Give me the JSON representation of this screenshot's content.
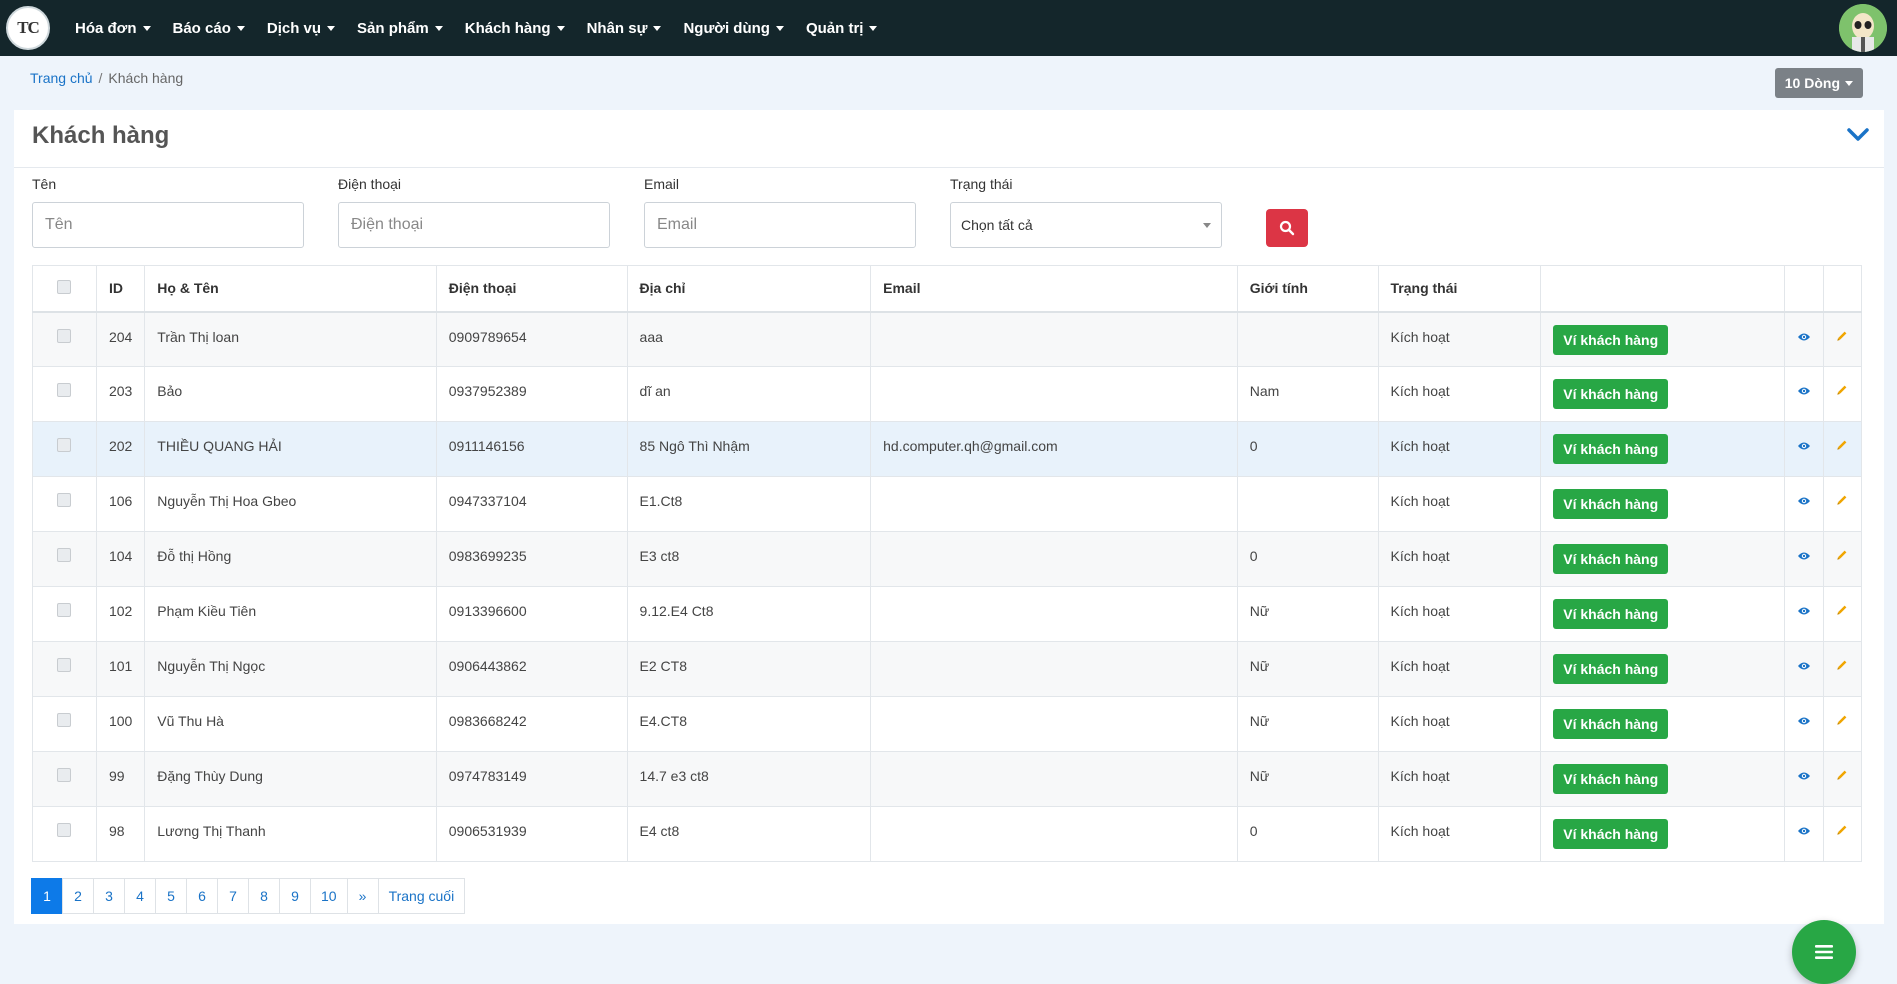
{
  "logo_text": "TC",
  "nav": {
    "items": [
      {
        "label": "Hóa đơn"
      },
      {
        "label": "Báo cáo"
      },
      {
        "label": "Dịch vụ"
      },
      {
        "label": "Sản phẩm"
      },
      {
        "label": "Khách hàng"
      },
      {
        "label": "Nhân sự"
      },
      {
        "label": "Người dùng"
      },
      {
        "label": "Quản trị"
      }
    ]
  },
  "breadcrumb": {
    "home": "Trang chủ",
    "sep": "/",
    "current": "Khách hàng"
  },
  "rows_per_page": "10 Dòng",
  "page_title": "Khách hàng",
  "filters": {
    "name": {
      "label": "Tên",
      "placeholder": "Tên"
    },
    "phone": {
      "label": "Điện thoại",
      "placeholder": "Điện thoại"
    },
    "email": {
      "label": "Email",
      "placeholder": "Email"
    },
    "status": {
      "label": "Trạng thái",
      "value": "Chọn tất cả"
    }
  },
  "table": {
    "headers": {
      "id": "ID",
      "name": "Họ & Tên",
      "phone": "Điện thoại",
      "address": "Địa chỉ",
      "email": "Email",
      "gender": "Giới tính",
      "status": "Trạng thái"
    },
    "wallet_label": "Ví khách hàng",
    "rows": [
      {
        "id": "204",
        "name": "Trần Thị loan",
        "phone": "0909789654",
        "address": "aaa",
        "email": "",
        "gender": "",
        "status": "Kích hoạt"
      },
      {
        "id": "203",
        "name": "Bảo",
        "phone": "0937952389",
        "address": "dĩ an",
        "email": "",
        "gender": "Nam",
        "status": "Kích hoạt"
      },
      {
        "id": "202",
        "name": "THIỀU QUANG HẢI",
        "phone": "0911146156",
        "address": "85 Ngô Thì Nhậm",
        "email": "hd.computer.qh@gmail.com",
        "gender": "0",
        "status": "Kích hoạt"
      },
      {
        "id": "106",
        "name": "Nguyễn Thị Hoa Gbeo",
        "phone": "0947337104",
        "address": "E1.Ct8",
        "email": "",
        "gender": "",
        "status": "Kích hoạt"
      },
      {
        "id": "104",
        "name": "Đỗ thị Hồng",
        "phone": "0983699235",
        "address": "E3 ct8",
        "email": "",
        "gender": "0",
        "status": "Kích hoạt"
      },
      {
        "id": "102",
        "name": "Phạm Kiều Tiên",
        "phone": "0913396600",
        "address": "9.12.E4 Ct8",
        "email": "",
        "gender": "Nữ",
        "status": "Kích hoạt"
      },
      {
        "id": "101",
        "name": "Nguyễn Thị Ngọc",
        "phone": "0906443862",
        "address": "E2 CT8",
        "email": "",
        "gender": "Nữ",
        "status": "Kích hoạt"
      },
      {
        "id": "100",
        "name": "Vũ Thu Hà",
        "phone": "0983668242",
        "address": "E4.CT8",
        "email": "",
        "gender": "Nữ",
        "status": "Kích hoạt"
      },
      {
        "id": "99",
        "name": "Đặng Thùy Dung",
        "phone": "0974783149",
        "address": "14.7 e3 ct8",
        "email": "",
        "gender": "Nữ",
        "status": "Kích hoạt"
      },
      {
        "id": "98",
        "name": "Lương Thị Thanh",
        "phone": "0906531939",
        "address": "E4 ct8",
        "email": "",
        "gender": "0",
        "status": "Kích hoạt"
      }
    ]
  },
  "pagination": {
    "pages": [
      "1",
      "2",
      "3",
      "4",
      "5",
      "6",
      "7",
      "8",
      "9",
      "10"
    ],
    "next": "»",
    "last": "Trang cuối",
    "active": "1"
  },
  "colors": {
    "navbar": "#14262b",
    "wallet_button": "#28a745",
    "search_button": "#dc3545",
    "link": "#1a73c7",
    "view_icon": "#1a73c7",
    "edit_icon": "#f0a500"
  }
}
